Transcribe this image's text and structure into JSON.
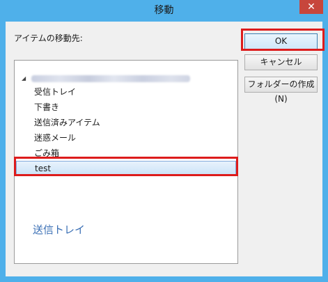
{
  "window": {
    "title": "移動",
    "close_glyph": "✕"
  },
  "dialog": {
    "prompt": "アイテムの移動先:"
  },
  "tree": {
    "expander_glyph": "◢",
    "items": [
      {
        "label": "受信トレイ"
      },
      {
        "label": "下書き"
      },
      {
        "label": "送信済みアイテム"
      },
      {
        "label": "迷惑メール"
      },
      {
        "label": "ごみ箱"
      },
      {
        "label": "test"
      }
    ],
    "drag_label": "送信トレイ"
  },
  "buttons": {
    "ok": "OK",
    "cancel": "キャンセル",
    "new_folder": "フォルダーの作成(N)"
  },
  "colors": {
    "titlebar": "#4fb0ea",
    "highlight": "#dd1c1c",
    "drag_text": "#3a6fb5"
  }
}
